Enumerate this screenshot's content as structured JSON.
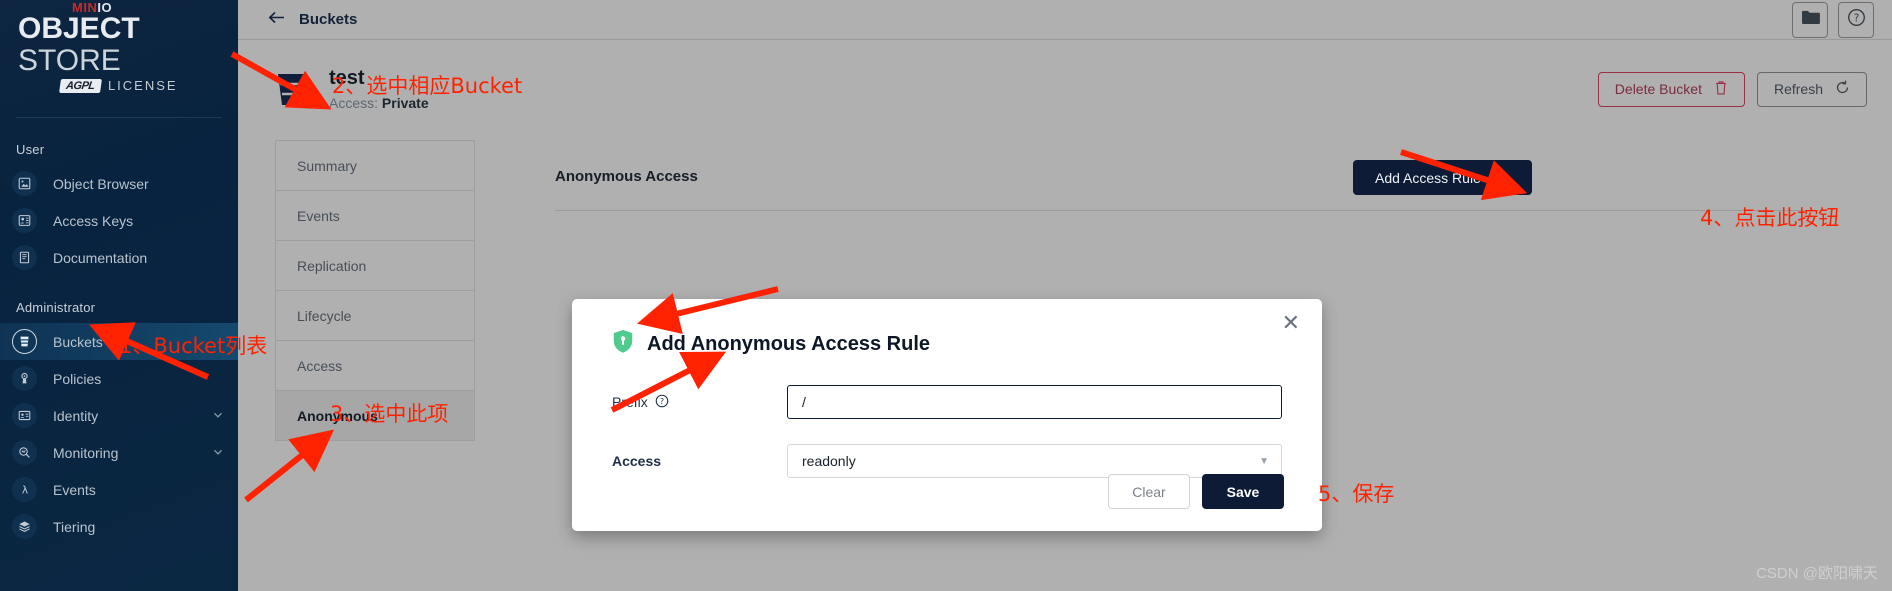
{
  "brand": {
    "name_top": "MIN",
    "name_top_suffix": "IO",
    "product_bold": "OBJECT",
    "product_light": " STORE",
    "license_badge": "AGPL",
    "license_text": "LICENSE"
  },
  "sidebar": {
    "sections": [
      {
        "label": "User",
        "items": [
          {
            "label": "Object Browser",
            "icon": "object-browser-icon",
            "expandable": false
          },
          {
            "label": "Access Keys",
            "icon": "access-keys-icon",
            "expandable": false
          },
          {
            "label": "Documentation",
            "icon": "documentation-icon",
            "expandable": false
          }
        ]
      },
      {
        "label": "Administrator",
        "items": [
          {
            "label": "Buckets",
            "icon": "buckets-icon",
            "expandable": false,
            "active": true
          },
          {
            "label": "Policies",
            "icon": "policies-icon",
            "expandable": false
          },
          {
            "label": "Identity",
            "icon": "identity-icon",
            "expandable": true
          },
          {
            "label": "Monitoring",
            "icon": "monitoring-icon",
            "expandable": true
          },
          {
            "label": "Events",
            "icon": "events-icon",
            "expandable": false
          },
          {
            "label": "Tiering",
            "icon": "tiering-icon",
            "expandable": false
          }
        ]
      }
    ]
  },
  "topbar": {
    "back_label": "Buckets",
    "back_icon": "arrow-left-icon",
    "folder_icon": "folder-icon",
    "help_icon": "help-circle-icon"
  },
  "bucket": {
    "icon": "bucket-icon",
    "name": "test",
    "access_label": "Access:",
    "access_value": "Private",
    "delete_label": "Delete Bucket",
    "delete_icon": "trash-icon",
    "refresh_label": "Refresh",
    "refresh_icon": "refresh-icon"
  },
  "tabs": [
    {
      "label": "Summary",
      "active": false
    },
    {
      "label": "Events",
      "active": false
    },
    {
      "label": "Replication",
      "active": false
    },
    {
      "label": "Lifecycle",
      "active": false
    },
    {
      "label": "Access",
      "active": false
    },
    {
      "label": "Anonymous",
      "active": true
    }
  ],
  "panel": {
    "title": "Anonymous Access",
    "add_rule_label": "Add Access Rule",
    "add_rule_icon": "plus-icon"
  },
  "modal": {
    "shield_icon": "shield-key-icon",
    "title": "Add Anonymous Access Rule",
    "close_icon": "close-icon",
    "prefix_label": "Prefix",
    "prefix_help_icon": "help-circle-icon",
    "prefix_value": "/",
    "access_label": "Access",
    "access_value": "readonly",
    "access_caret_icon": "chevron-down-icon",
    "clear_label": "Clear",
    "save_label": "Save"
  },
  "annotations": {
    "a1": "1、Bucket列表",
    "a2": "2、选中相应Bucket",
    "a3": "3、选中此项",
    "a4": "4、点击此按钮",
    "a5": "5、保存"
  },
  "watermark": "CSDN @欧阳啸天",
  "colors": {
    "sidebar_bg": "#0a2742",
    "accent_dark": "#0d1b36",
    "annotation_red": "#ff2200",
    "danger": "#9b2f45",
    "shield_green": "#4ecb8d",
    "page_bg": "#b0b0b0"
  }
}
